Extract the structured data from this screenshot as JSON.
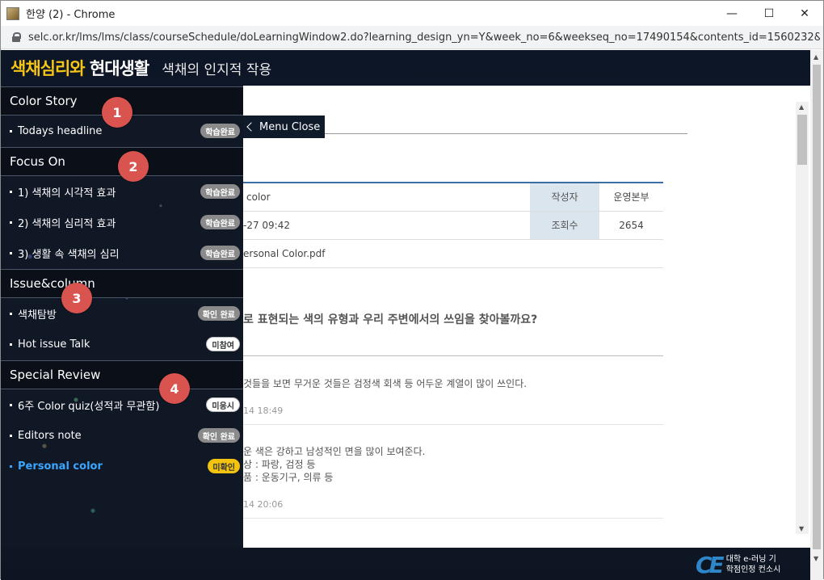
{
  "window": {
    "title": "한양 (2) - Chrome",
    "controls": {
      "minimize": "—",
      "maximize": "☐",
      "close": "✕"
    }
  },
  "address_bar": {
    "url": "selc.or.kr/lms/lms/class/courseSchedule/doLearningWindow2.do?learning_design_yn=Y&week_no=6&weekseq_no=17490154&contents_id=1560232&..."
  },
  "header": {
    "logo_part1": "색채심리와",
    "logo_part2": " 현대생활",
    "page_title": "색채의 인지적 작용"
  },
  "menu_close": {
    "label": "Menu Close"
  },
  "sidebar": {
    "sections": [
      {
        "number": "1",
        "title": "Color Story",
        "items": [
          {
            "label": "Todays headline",
            "badge": "학습완료"
          }
        ]
      },
      {
        "number": "2",
        "title": "Focus On",
        "items": [
          {
            "label": "1) 색채의 시각적 효과",
            "badge": "학습완료"
          },
          {
            "label": "2) 색채의 심리적 효과",
            "badge": "학습완료"
          },
          {
            "label": "3) 생활 속 색채의 심리",
            "badge": "학습완료"
          }
        ]
      },
      {
        "number": "3",
        "title": "Issue&column",
        "items": [
          {
            "label": "색채탐방",
            "badge": "확인 완료"
          },
          {
            "label": "Hot issue Talk",
            "badge": "미참여"
          }
        ]
      },
      {
        "number": "4",
        "title": "Special Review",
        "items": [
          {
            "label": "6주 Color quiz(성적과 무관함)",
            "badge": "미응시"
          },
          {
            "label": "Editors note",
            "badge": "확인 완료"
          },
          {
            "label": "Personal color",
            "badge": "미확인"
          }
        ]
      }
    ]
  },
  "post": {
    "title_fragment": "color",
    "author_label": "작성자",
    "author_value": "운영본부",
    "date_fragment": "-27 09:42",
    "views_label": "조회수",
    "views_value": "2654",
    "attachment_fragment": "ersonal Color.pdf",
    "question": "로 표현되는 색의 유형과 우리 주변에서의 쓰임을 찾아볼까요?"
  },
  "comments": [
    {
      "text": "것들을 보면 무거운 것들은 검정색 회색 등 어두운 계열이 많이 쓰인다.",
      "date": "14 18:49"
    },
    {
      "line1": "운 색은 강하고 남성적인 면을 많이 보여준다.",
      "line2": "상 : 파랑, 검정 등",
      "line3": "품 : 운동기구, 의류 등",
      "date": "14 20:06"
    }
  ],
  "footer": {
    "logo": "CE",
    "line1": "대학 e-러닝 기",
    "line2": "학점인정 컨소시"
  },
  "colors": {
    "accent_blue": "#39a6ff",
    "badge_grey": "#8a8a8a",
    "badge_yellow": "#f2c40f",
    "number_circle": "#d9534f",
    "logo_yellow": "#f5c518"
  }
}
